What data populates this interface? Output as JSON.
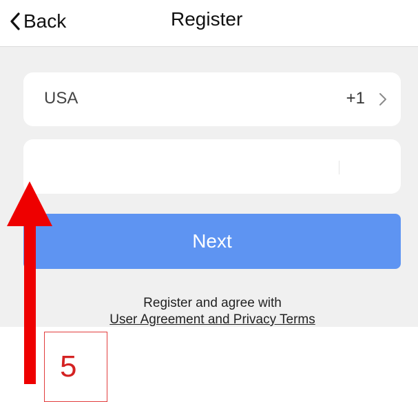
{
  "header": {
    "back_label": "Back",
    "title": "Register"
  },
  "country": {
    "name": "USA",
    "code": "+1"
  },
  "phone": {
    "value": "",
    "placeholder": ""
  },
  "next_label": "Next",
  "agreement": {
    "text": "Register and agree with",
    "link": "User Agreement and Privacy Terms"
  },
  "annotation": {
    "step": "5"
  },
  "icons": {
    "back": "chevron-left-icon",
    "country_select": "chevron-right-icon",
    "annotation": "arrow-up-icon"
  },
  "colors": {
    "primary_button": "#5e94f2",
    "background": "#f0f0f0",
    "annotation": "#ee0000"
  }
}
